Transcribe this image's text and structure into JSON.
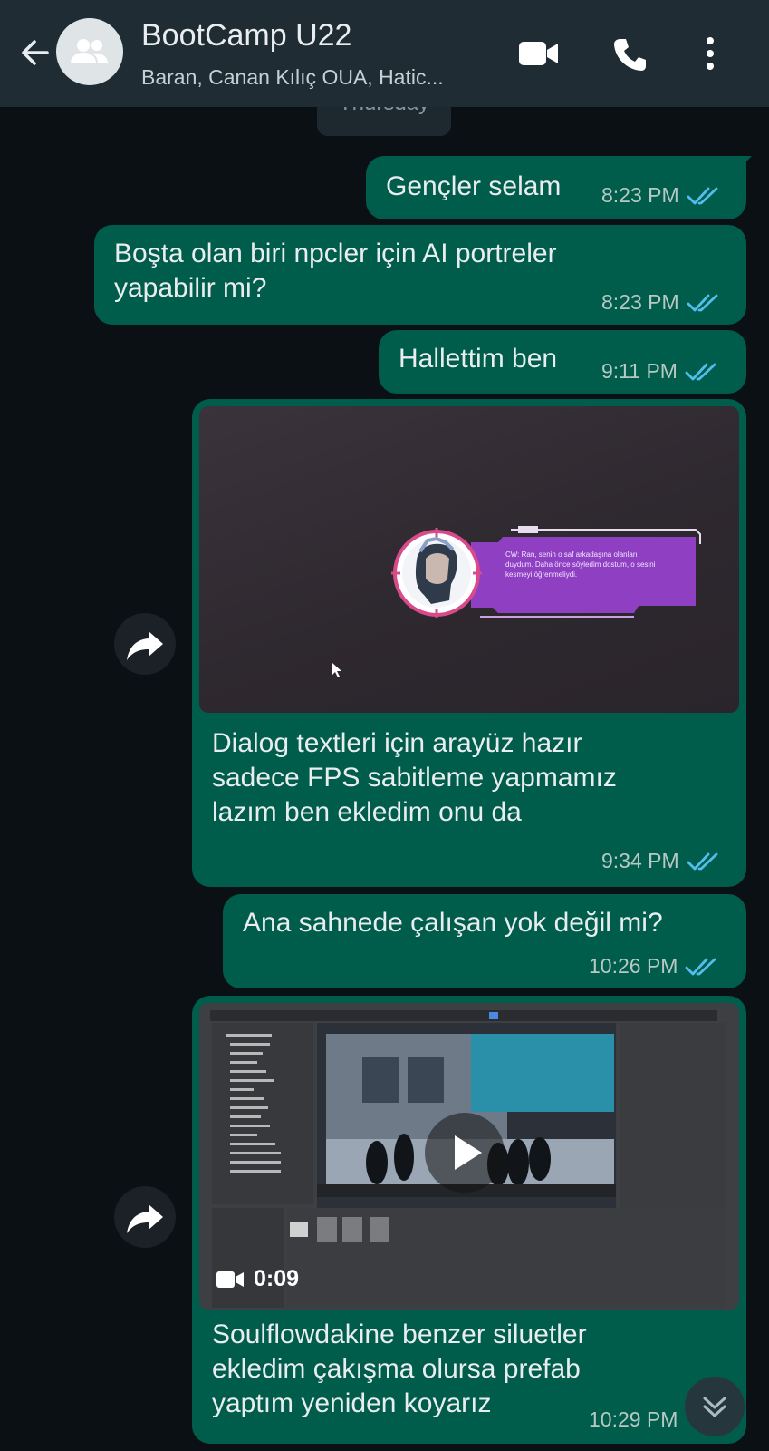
{
  "header": {
    "title": "BootCamp U22",
    "subtitle": "Baran, Canan Kılıç OUA, Hatic..."
  },
  "date_label": "Thursday",
  "messages": [
    {
      "text": "Gençler selam",
      "time": "8:23 PM"
    },
    {
      "text_lines": [
        "Boşta olan biri npcler için AI portreler",
        "yapabilir mi?"
      ],
      "time": "8:23 PM"
    },
    {
      "text": "Hallettim ben",
      "time": "9:11 PM"
    },
    {
      "image_caption": [
        "CW: Ran, senin o saf arkadaşına olanları",
        "duydum. Daha önce söyledim dostum, o sesini",
        "kesmeyi öğrenmeliydi."
      ],
      "text_lines": [
        "Dialog textleri için arayüz hazır",
        "sadece FPS sabitleme yapmamız",
        "lazım ben ekledim onu da"
      ],
      "time": "9:34 PM"
    },
    {
      "text": "Ana sahnede çalışan yok değil mi?",
      "time": "10:26 PM"
    },
    {
      "video_duration": "0:09",
      "text_lines": [
        "Soulflowdakine benzer siluetler",
        "ekledim çakışma olursa prefab",
        "yaptım yeniden koyarız"
      ],
      "time": "10:29 PM"
    }
  ],
  "colors": {
    "header_bg": "#1f2c34",
    "chat_bg": "#0b1014",
    "bubble_out": "#005c4b",
    "read_ticks": "#53bdeb"
  }
}
